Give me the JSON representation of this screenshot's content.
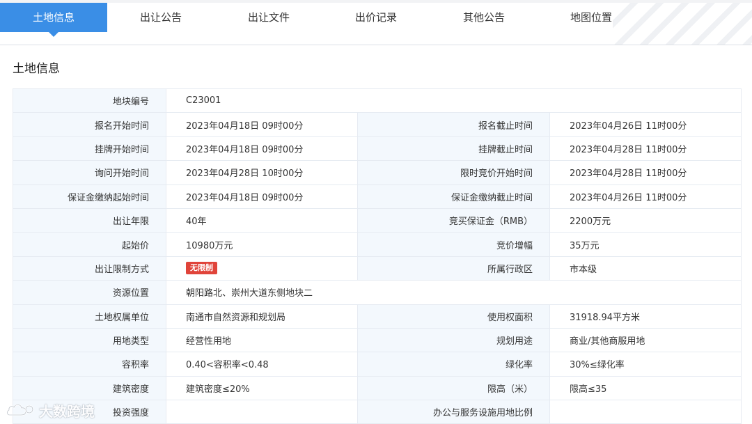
{
  "tabs": [
    {
      "label": "土地信息",
      "active": true
    },
    {
      "label": "出让公告"
    },
    {
      "label": "出让文件"
    },
    {
      "label": "出价记录"
    },
    {
      "label": "其他公告"
    },
    {
      "label": "地图位置"
    }
  ],
  "section_title": "土地信息",
  "rows": {
    "r0": {
      "l1": "地块编号",
      "v1": "C23001"
    },
    "r1": {
      "l1": "报名开始时间",
      "v1": "2023年04月18日 09时00分",
      "l2": "报名截止时间",
      "v2": "2023年04月26日 11时00分"
    },
    "r2": {
      "l1": "挂牌开始时间",
      "v1": "2023年04月18日 09时00分",
      "l2": "挂牌截止时间",
      "v2": "2023年04月28日 11时00分"
    },
    "r3": {
      "l1": "询问开始时间",
      "v1": "2023年04月28日 10时00分",
      "l2": "限时竞价开始时间",
      "v2": "2023年04月28日 11时00分"
    },
    "r4": {
      "l1": "保证金缴纳起始时间",
      "v1": "2023年04月18日 09时00分",
      "l2": "保证金缴纳截止时间",
      "v2": "2023年04月26日 11时00分"
    },
    "r5": {
      "l1": "出让年限",
      "v1": "40年",
      "l2": "竞买保证金（RMB）",
      "v2": "2200万元"
    },
    "r6": {
      "l1": "起始价",
      "v1": "10980万元",
      "l2": "竞价增幅",
      "v2": "35万元"
    },
    "r7": {
      "l1": "出让限制方式",
      "badge": "无限制",
      "badge_color": "#e0443a",
      "l2": "所属行政区",
      "v2": "市本级"
    },
    "r8": {
      "l1": "资源位置",
      "v1": "朝阳路北、崇州大道东侧地块二"
    },
    "r9": {
      "l1": "土地权属单位",
      "v1": "南通市自然资源和规划局",
      "l2": "使用权面积",
      "v2": "31918.94平方米"
    },
    "r10": {
      "l1": "用地类型",
      "v1": "经营性用地",
      "l2": "规划用途",
      "v2": "商业/其他商服用地"
    },
    "r11": {
      "l1": "容积率",
      "v1": "0.40<容积率<0.48",
      "l2": "绿化率",
      "v2": "30%≤绿化率"
    },
    "r12": {
      "l1": "建筑密度",
      "v1": "建筑密度≤20%",
      "l2": "限高（米）",
      "v2": "限高≤35"
    },
    "r13": {
      "l1": "投资强度",
      "v1": "",
      "l2": "办公与服务设施用地比例",
      "v2": ""
    }
  },
  "watermark": {
    "text": "大数跨境",
    "icon": "cloud-logo-icon"
  },
  "colors": {
    "accent": "#3a8ee6",
    "label_bg": "#f3f8fd",
    "border": "#e6ebf2"
  }
}
